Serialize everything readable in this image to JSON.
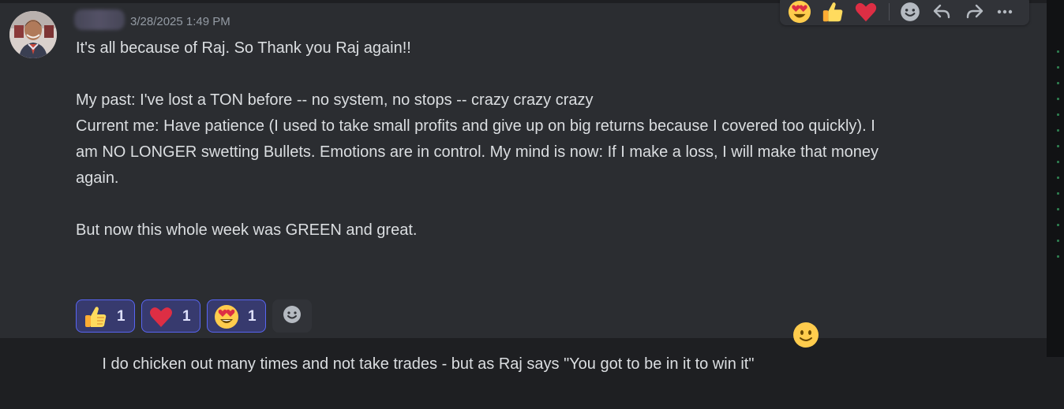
{
  "message": {
    "author_blurred": true,
    "timestamp": "3/28/2025 1:49 PM",
    "lines": [
      "It's all because of Raj. So Thank you Raj again!!",
      "",
      "My past: I've lost a TON before -- no system, no stops -- crazy crazy crazy",
      "Current me: Have patience (I used to take small profits and give up on big returns because I covered too quickly). I",
      "am NO LONGER swetting Bullets. Emotions are in control. My mind is now: If I make a loss, I will make that money",
      "again.",
      "",
      "But now this whole week was GREEN and great.",
      "",
      "I do chicken out many times and not take trades - but as Raj says \"You got to be in it to win it\""
    ],
    "inline_emoji": "slightly-smiling-face-icon"
  },
  "reactions": [
    {
      "emoji": "thumbs-up-icon",
      "count": "1"
    },
    {
      "emoji": "heart-icon",
      "count": "1"
    },
    {
      "emoji": "heart-eyes-icon",
      "count": "1"
    }
  ],
  "add_reaction_icon": "add-reaction-icon",
  "toolbar": [
    {
      "icon": "heart-eyes-icon"
    },
    {
      "icon": "thumbs-up-icon"
    },
    {
      "icon": "heart-icon"
    },
    {
      "icon": "add-reaction-icon"
    },
    {
      "icon": "reply-icon"
    },
    {
      "icon": "forward-icon"
    },
    {
      "icon": "more-icon"
    }
  ],
  "colors": {
    "background": "#1e1f22",
    "message_panel": "#2b2d31",
    "text": "#dbdee1",
    "timestamp": "#949ba4",
    "reaction_bg": "#373a6e",
    "reaction_border": "#5865f2"
  }
}
